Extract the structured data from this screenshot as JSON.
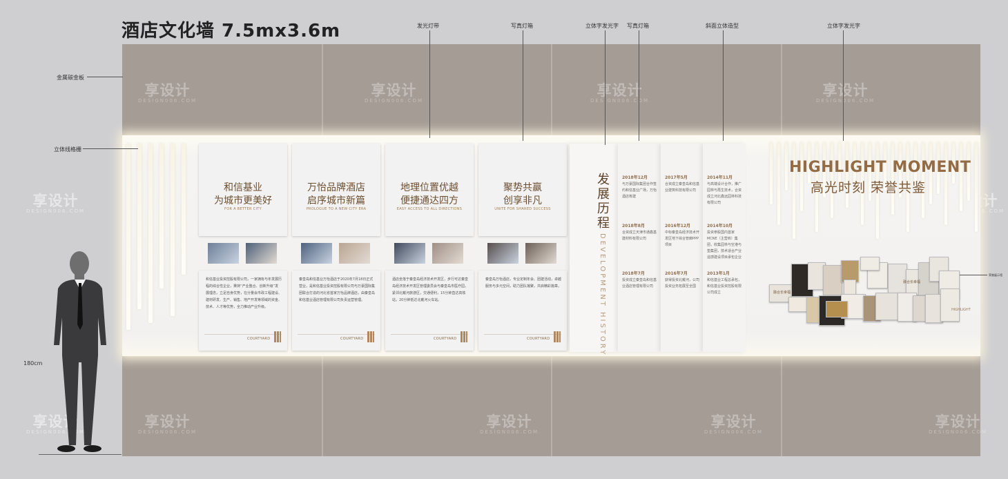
{
  "title": "酒店文化墙 7.5mx3.6m",
  "callouts": {
    "light_strip": "发光灯带",
    "photo_lightbox_1": "写真灯箱",
    "led_letters_1": "立体字发光字",
    "photo_lightbox_2": "写真灯箱",
    "slanted_3d": "斜面立体造型",
    "led_letters_2": "立体字发光字",
    "metal_panel": "金属碳金板",
    "grille": "立体线格栅",
    "height": "180cm",
    "honor_panel": "荣誉展示墙"
  },
  "watermark": {
    "text": "享设计",
    "sub": "DESIGN006.COM"
  },
  "cards": [
    {
      "heading1": "和信基业",
      "heading2": "为城市更美好",
      "subtitle": "FOR A BETTER CITY",
      "body": "和信基业投资控股有限公司，一家拥有与年发展历程的综合性企业，秉持“产业整合、创新升级”发展理念，立足自身优势，在分量会市政工程建设、建材研发、生产、销售、地产开发等领域的资金、技术、人才等优势，全力推动产业升级。",
      "logo": "COURTYARD"
    },
    {
      "heading1": "万怡品牌酒店",
      "heading2": "启序城市新篇",
      "subtitle": "PROLOGUE TO A NEW CITY ERA",
      "body": "秦皇岛和信基业万怡酒店于2020年7月18日正式营业，是和信基业投资控股有限公司与万豪国际集团联合打造的河北省首家万怡品牌酒店，由秦皇岛和信基业酒店管理有限公司负责运营管理。",
      "logo": "COURTYARD"
    },
    {
      "heading1": "地理位置优越",
      "heading2": "便捷通达四方",
      "subtitle": "EASY ACCESS TO ALL DIRECTIONS",
      "body": "酒店坐落于秦皇岛经济技术开发区，步行可达秦皇岛经济技术开发区管理委员会与秦皇岛市医疗园，紧邻北戴河旅游区，交通便利，15分钟直达高铁站，20分钟抵达北戴河火车站。",
      "logo": "COURTYARD"
    },
    {
      "heading1": "聚势共赢",
      "heading2": "创享非凡",
      "subtitle": "UNITE FOR SHARED SUCCESS",
      "body": "秦皇岛万怡酒店，专业定制年会、团建活动，卓越服务与多元空间，助力团队凝聚，共启精彩篇章。",
      "logo": "COURTYARD"
    }
  ],
  "timeline": {
    "title": "发展历程",
    "title_en": "DEVELOPMENT HISTORY",
    "columns": [
      [
        {
          "date": "2018年12月",
          "text": "与万豪国际集团合作签约和信基业广场，万怡酒店筹建"
        },
        {
          "date": "2018年8月",
          "text": "合资成立天津市通鑫基建材料有限公司"
        },
        {
          "date": "2018年7月",
          "text": "投资成立秦皇岛和信基业酒店管理有限公司"
        }
      ],
      [
        {
          "date": "2017年5月",
          "text": "合资成立秦皇岛和信基业建筑科技有限公司"
        },
        {
          "date": "2016年12月",
          "text": "中标秦皇岛经济技术开发区地下综合管廊PPP项目"
        },
        {
          "date": "2016年7月",
          "text": "获得投资北戴河，公司投资业务拓展至全国"
        }
      ],
      [
        {
          "date": "2014年11月",
          "text": "与高端设计合作，推广园林与再生技术，合资成立河北鑫远园林科技有限公司"
        },
        {
          "date": "2014年10月",
          "text": "投资参股国内首家MCNE（主营商）集团，收集园林与空港与垫集团，技术适合产业遥感建设项目承包企业"
        },
        {
          "date": "2013年1月",
          "text": "和信基业工程总承包，和信基业投资控股有限公司成立"
        }
      ]
    ]
  },
  "highlight": {
    "title_en": "HIGHLIGHT MOMENT",
    "title_cn": "高光时刻 荣誉共鉴"
  },
  "honor_labels": [
    "融合长幸福",
    "融合长幸福",
    "HIGHLIGHT"
  ],
  "colors": {
    "wall": "#a59c95",
    "band": "#f3f2f1",
    "accent": "#936c46",
    "card": "#f3f2f2"
  }
}
